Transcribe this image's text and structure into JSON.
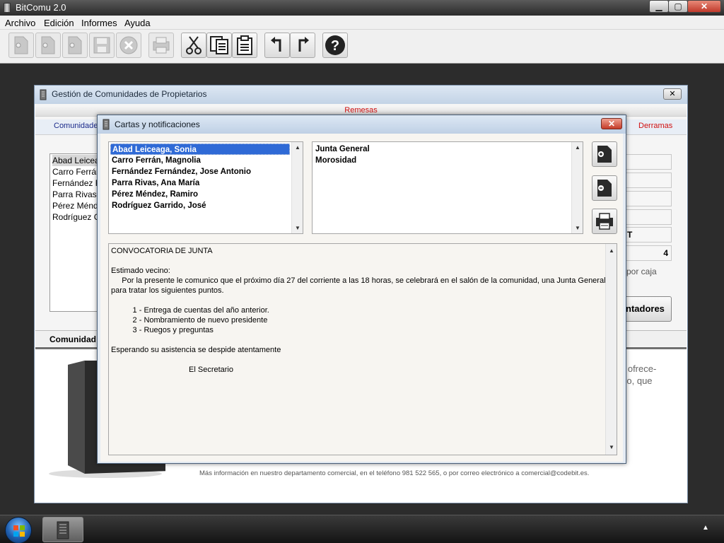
{
  "app": {
    "title": "BitComu 2.0"
  },
  "window_buttons": {
    "minimize": "▁",
    "maximize": "▢",
    "close": "✕"
  },
  "menu": [
    "Archivo",
    "Edición",
    "Informes",
    "Ayuda"
  ],
  "toolbar": [
    {
      "icon": "new-document-icon",
      "enabled": false
    },
    {
      "icon": "remove-document-icon",
      "enabled": false
    },
    {
      "icon": "document-icon",
      "enabled": false
    },
    {
      "icon": "save-icon",
      "enabled": false
    },
    {
      "icon": "delete-icon",
      "enabled": false
    },
    {
      "icon": "print-icon",
      "enabled": false
    },
    {
      "icon": "cut-icon",
      "enabled": true
    },
    {
      "icon": "copy-icon",
      "enabled": true
    },
    {
      "icon": "paste-icon",
      "enabled": true
    },
    {
      "icon": "undo-icon",
      "enabled": true
    },
    {
      "icon": "redo-icon",
      "enabled": true
    },
    {
      "icon": "help-icon",
      "enabled": true
    }
  ],
  "bg_window": {
    "title": "Gestión de Comunidades de Propietarios",
    "close": "✕",
    "remesas_tab": "Remesas",
    "tab_left": "Comunidades",
    "tab_right": "Derramas",
    "list": [
      "Abad Leiceaga, Sonia",
      "Carro Ferrán, Magnolia",
      "Fernández Fernández, Jose Antonio",
      "Parra Rivas, Ana María",
      "Pérez Méndez, Ramiro",
      "Rodríguez Garrido, José"
    ],
    "field_t": "T",
    "field_4": "4",
    "por_caja": "por caja",
    "btn_partial": "ntadores",
    "comunidad_label": "Comunidad:",
    "promo_line1": "e ofrece-",
    "promo_line2": "cio, que",
    "promo_footer": "Más información en nuestro departamento comercial, en el teléfono 981 522 565, o por correo electrónico a comercial@codebit.es."
  },
  "modal": {
    "title": "Cartas y notificaciones",
    "close": "✕",
    "owners": [
      "Abad Leiceaga, Sonia",
      "Carro Ferrán, Magnolia",
      "Fernández Fernández, Jose Antonio",
      "Parra Rivas, Ana María",
      "Pérez Méndez, Ramiro",
      "Rodríguez Garrido, José"
    ],
    "selected_owner": 0,
    "templates": [
      "Junta General",
      "Morosidad"
    ],
    "side_buttons": [
      "add-letter-icon",
      "remove-letter-icon",
      "print-icon"
    ],
    "letter": [
      "CONVOCATORIA DE JUNTA",
      "",
      "Estimado vecino:",
      "     Por la presente le comunico que el próximo día 27 del corriente a las 18 horas, se celebrará en el salón de la comunidad, una Junta General",
      "para tratar los siguientes puntos.",
      "",
      "          1 - Entrega de cuentas del año anterior.",
      "          2 - Nombramiento de nuevo presidente",
      "          3 - Ruegos y preguntas",
      "",
      "Esperando su asistencia se despide atentamente",
      "",
      "                                    El Secretario"
    ]
  },
  "taskbar": {
    "tray_arrow": "▲"
  },
  "colors": {
    "accent_red": "#d01010",
    "selection": "#2f6ad6",
    "tab_blue": "#1a2a8a"
  }
}
